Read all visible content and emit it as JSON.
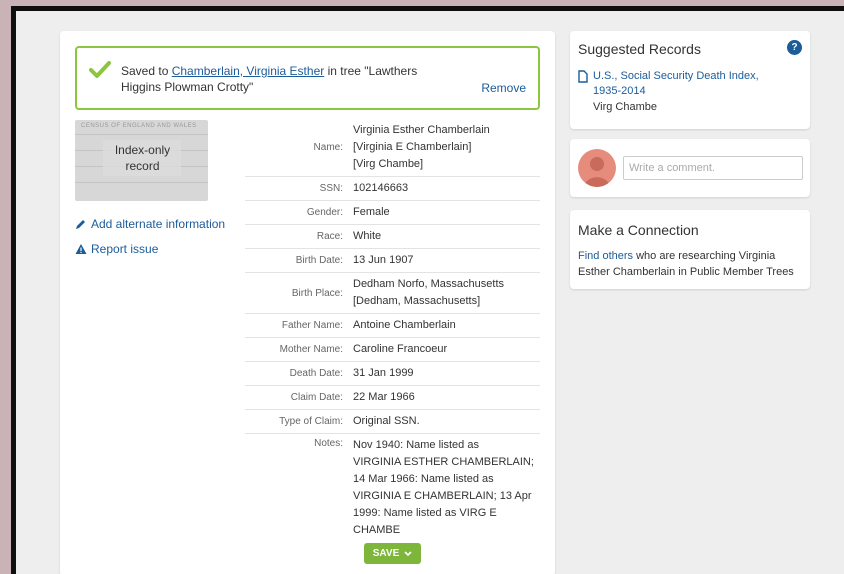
{
  "saved": {
    "prefix": "Saved to",
    "person_link": "Chamberlain, Virginia Esther",
    "suffix": "in tree \"Lawthers Higgins Plowman Crotty\"",
    "remove_label": "Remove"
  },
  "index_image": {
    "header": "CENSUS OF ENGLAND AND WALES",
    "label": "Index-only record"
  },
  "side_links": {
    "add_alternate": "Add alternate information",
    "report_issue": "Report issue"
  },
  "record": {
    "fields": [
      {
        "label": "Name:",
        "value_lines": [
          "Virginia Esther Chamberlain",
          "[Virginia E Chamberlain]",
          "[Virg Chambe]"
        ]
      },
      {
        "label": "SSN:",
        "value_lines": [
          "102146663"
        ]
      },
      {
        "label": "Gender:",
        "value_lines": [
          "Female"
        ]
      },
      {
        "label": "Race:",
        "value_lines": [
          "White"
        ]
      },
      {
        "label": "Birth Date:",
        "value_lines": [
          "13 Jun 1907"
        ]
      },
      {
        "label": "Birth Place:",
        "value_lines": [
          "Dedham Norfo, Massachusetts",
          "[Dedham, Massachusetts]"
        ]
      },
      {
        "label": "Father Name:",
        "value_lines": [
          "Antoine Chamberlain"
        ]
      },
      {
        "label": "Mother Name:",
        "value_lines": [
          "Caroline Francoeur"
        ]
      },
      {
        "label": "Death Date:",
        "value_lines": [
          "31 Jan 1999"
        ]
      },
      {
        "label": "Claim Date:",
        "value_lines": [
          "22 Mar 1966"
        ]
      },
      {
        "label": "Type of Claim:",
        "value_lines": [
          "Original SSN."
        ]
      },
      {
        "label": "Notes:",
        "value_lines": [
          "Nov 1940: Name listed as",
          "VIRGINIA ESTHER CHAMBERLAIN;",
          "14 Mar 1966: Name listed as",
          "VIRGINIA E CHAMBERLAIN; 13 Apr",
          "1999: Name listed as VIRG E",
          "CHAMBE"
        ]
      }
    ],
    "save_label": "SAVE"
  },
  "suggested": {
    "title": "Suggested Records",
    "help_glyph": "?",
    "record_link": "U.S., Social Security Death Index, 1935-2014",
    "record_name": "Virg Chambe"
  },
  "comment": {
    "placeholder": "Write a comment."
  },
  "connection": {
    "title": "Make a Connection",
    "link": "Find others",
    "text": " who are researching Virginia Esther Chamberlain in Public Member Trees"
  },
  "colors": {
    "accent_green": "#8cc63f",
    "link_blue": "#1c5c99",
    "save_green": "#7eb53b"
  }
}
